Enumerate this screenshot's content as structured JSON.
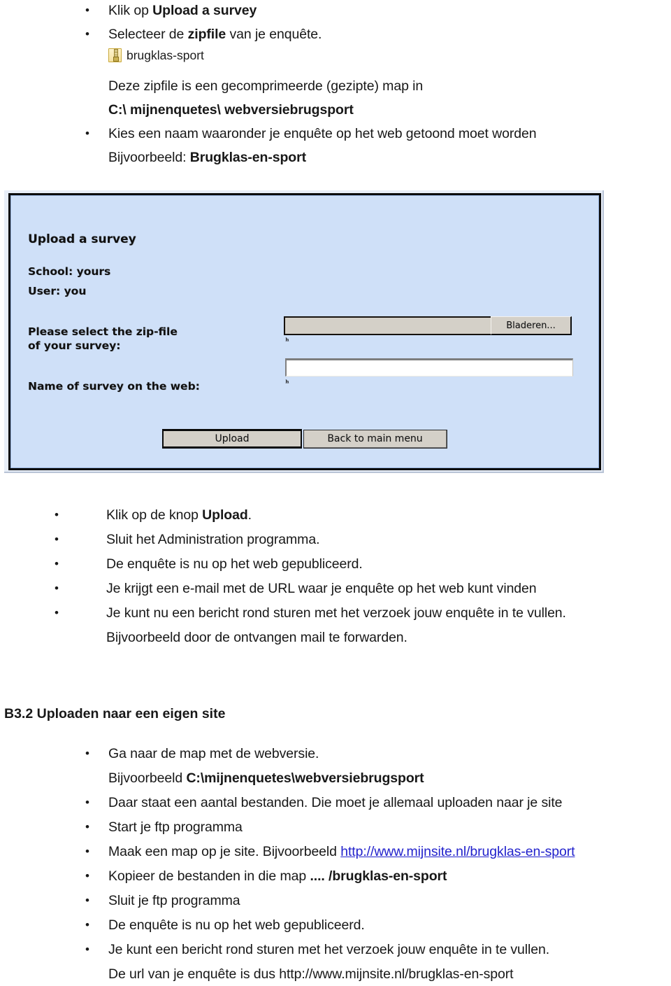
{
  "top_list": {
    "items": [
      {
        "bullet": "•",
        "segments": [
          {
            "text": "Klik op ",
            "bold": false
          },
          {
            "text": "Upload a survey",
            "bold": true
          }
        ]
      },
      {
        "bullet": "•",
        "segments": [
          {
            "text": "Selecteer de ",
            "bold": false
          },
          {
            "text": "zipfile",
            "bold": true
          },
          {
            "text": " van je enquête.",
            "bold": false
          }
        ]
      }
    ],
    "zipfile": {
      "icon": "zip-archive-icon",
      "caption": "brugklas-sport"
    },
    "sub_lines": [
      {
        "segments": [
          {
            "text": "Deze zipfile is een gecomprimeerde (gezipte) map in",
            "bold": false
          }
        ]
      },
      {
        "segments": [
          {
            "text": "C:\\ mijnenquetes\\ webversiebrugsport",
            "bold": true
          }
        ]
      }
    ],
    "items2": [
      {
        "bullet": "•",
        "segments": [
          {
            "text": "Kies een naam waaronder je enquête op het web getoond  moet worden",
            "bold": false
          }
        ]
      }
    ],
    "sub_lines2": [
      {
        "segments": [
          {
            "text": "Bijvoorbeeld:  ",
            "bold": false
          },
          {
            "text": "Brugklas-en-sport",
            "bold": true
          }
        ]
      }
    ]
  },
  "screenshot": {
    "title": "Upload a survey",
    "school_line": "School:  yours",
    "user_line": "User:  you",
    "zip_label": "Please select the zip-file of your survey:",
    "name_label": "Name of survey on the web:",
    "browse_button": "Bladeren...",
    "file_value": "",
    "name_value": "",
    "required_mark": "ʰ",
    "upload_button": "Upload",
    "back_button": "Back to main menu",
    "background_color": "#cfe0f8",
    "control_color": "#d4d0c8"
  },
  "mid_list": {
    "items": [
      {
        "bullet": "•",
        "segments": [
          {
            "text": "Klik op de knop ",
            "bold": false
          },
          {
            "text": "Upload",
            "bold": true
          },
          {
            "text": ".",
            "bold": false
          }
        ]
      },
      {
        "bullet": "•",
        "segments": [
          {
            "text": "Sluit het Administration programma.",
            "bold": false
          }
        ]
      },
      {
        "bullet": "•",
        "segments": [
          {
            "text": "De enquête  is nu op het web gepubliceerd.",
            "bold": false
          }
        ]
      },
      {
        "bullet": "•",
        "segments": [
          {
            "text": "Je krijgt een e-mail met de URL waar je enquête op het web kunt vinden",
            "bold": false
          }
        ]
      },
      {
        "bullet": "•",
        "segments": [
          {
            "text": "Je kunt nu een bericht rond sturen met het verzoek jouw enquête in te vullen.",
            "bold": false
          }
        ]
      }
    ],
    "tail_lines": [
      {
        "segments": [
          {
            "text": "Bijvoorbeeld door de ontvangen mail te forwarden.",
            "bold": false
          }
        ]
      }
    ]
  },
  "section": {
    "heading": "B3.2  Uploaden naar een  eigen site",
    "items": [
      {
        "bullet": "•",
        "segments": [
          {
            "text": "Ga naar de map met de webversie.",
            "bold": false
          }
        ]
      },
      {
        "bullet": "",
        "segments": [
          {
            "text": "Bijvoorbeeld ",
            "bold": false
          },
          {
            "text": "C:\\mijnenquetes\\webversiebrugsport",
            "bold": true
          }
        ]
      },
      {
        "bullet": "•",
        "segments": [
          {
            "text": "Daar staat een aantal bestanden. Die moet je allemaal uploaden naar je site",
            "bold": false
          }
        ]
      },
      {
        "bullet": "•",
        "segments": [
          {
            "text": "Start je ftp programma",
            "bold": false
          }
        ]
      },
      {
        "bullet": "•",
        "segments": [
          {
            "text": "Maak een map op je site. Bijvoorbeeld ",
            "bold": false
          },
          {
            "text": "http://www.mijnsite.nl/brugklas-en-sport",
            "bold": false,
            "link": true
          }
        ]
      },
      {
        "bullet": "•",
        "segments": [
          {
            "text": "Kopieer de bestanden in die map  ",
            "bold": false
          },
          {
            "text": ".... /brugklas-en-sport",
            "bold": true
          }
        ]
      },
      {
        "bullet": "•",
        "segments": [
          {
            "text": "Sluit je ftp programma",
            "bold": false
          }
        ]
      },
      {
        "bullet": "•",
        "segments": [
          {
            "text": "De enquête  is nu op het web gepubliceerd.",
            "bold": false
          }
        ]
      },
      {
        "bullet": "•",
        "segments": [
          {
            "text": "Je kunt een bericht rond sturen met het verzoek jouw enquête in te vullen.",
            "bold": false
          }
        ]
      },
      {
        "bullet": "",
        "segments": [
          {
            "text": "De url van je enquête is dus http://www.mijnsite.nl/brugklas-en-sport",
            "bold": false
          }
        ]
      }
    ]
  },
  "colors": {
    "link": "#2222cc",
    "text": "#181818",
    "app_bg": "#cfe0f8"
  }
}
